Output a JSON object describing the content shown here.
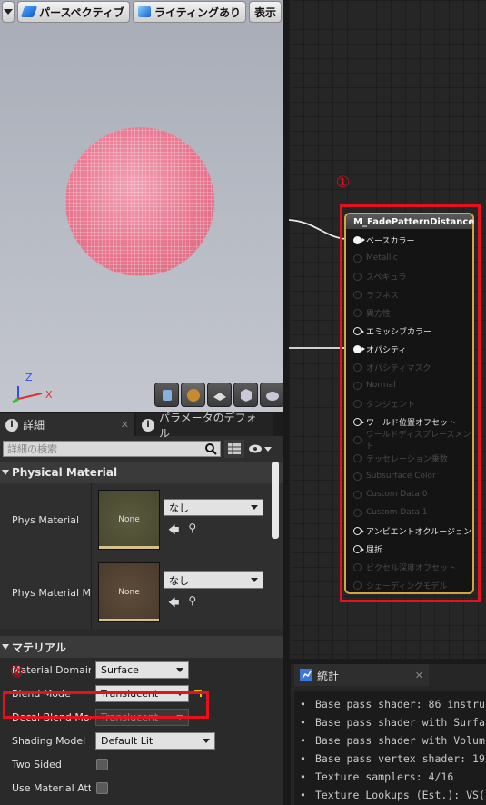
{
  "viewport": {
    "toolbar": {
      "perspective_label": "パースペクティブ",
      "lighting_label": "ライティングあり",
      "show_label": "表示"
    },
    "axis": {
      "x": "X",
      "z": "Z"
    }
  },
  "details": {
    "tab_details": "詳細",
    "tab_params": "パラメータのデフォル",
    "search_placeholder": "詳細の検索",
    "physical_section": "Physical Material",
    "phys_material_label": "Phys Material",
    "phys_material_value": "なし",
    "phys_material_thumb": "None",
    "phys_material_map_label": "Phys Material Ma",
    "phys_material_map_value": "なし",
    "phys_material_map_thumb": "None",
    "material_section": "マテリアル",
    "material_domain_label": "Material Domain",
    "material_domain_value": "Surface",
    "blend_mode_label": "Blend Mode",
    "blend_mode_value": "Translucent",
    "decal_blend_label": "Decal Blend Mode",
    "decal_blend_value": "Translucent",
    "shading_model_label": "Shading Model",
    "shading_model_value": "Default Lit",
    "two_sided_label": "Two Sided",
    "use_material_attr_label": "Use Material Attri"
  },
  "annotations": {
    "one": "①",
    "two": "②"
  },
  "node": {
    "title": "M_FadePatternDistance",
    "pins": [
      {
        "label": "ベースカラー",
        "state": "connected"
      },
      {
        "label": "Metallic",
        "state": "dim"
      },
      {
        "label": "スペキュラ",
        "state": "dim"
      },
      {
        "label": "ラフネス",
        "state": "dim"
      },
      {
        "label": "異方性",
        "state": "dim"
      },
      {
        "label": "エミッシブカラー",
        "state": "hollow"
      },
      {
        "label": "オパシティ",
        "state": "connected"
      },
      {
        "label": "オパシティマスク",
        "state": "dim"
      },
      {
        "label": "Normal",
        "state": "dim"
      },
      {
        "label": "タンジェント",
        "state": "dim"
      },
      {
        "label": "ワールド位置オフセット",
        "state": "hollow"
      },
      {
        "label": "ワールドディスプレースメント",
        "state": "dim"
      },
      {
        "label": "テッセレーション乗数",
        "state": "dim"
      },
      {
        "label": "Subsurface Color",
        "state": "dim"
      },
      {
        "label": "Custom Data 0",
        "state": "dim"
      },
      {
        "label": "Custom Data 1",
        "state": "dim"
      },
      {
        "label": "アンビエントオクルージョン",
        "state": "hollow"
      },
      {
        "label": "屈折",
        "state": "hollow"
      },
      {
        "label": "ピクセル深度オフセット",
        "state": "dim"
      },
      {
        "label": "シェーディングモデル",
        "state": "dim"
      }
    ]
  },
  "stats": {
    "tab_label": "統計",
    "lines": [
      "Base pass shader: 86 instru",
      "Base pass shader with Surfa",
      "Base pass shader with Volum",
      "Base pass vertex shader: 19",
      "Texture samplers: 4/16",
      "Texture Lookups (Est.): VS("
    ]
  }
}
